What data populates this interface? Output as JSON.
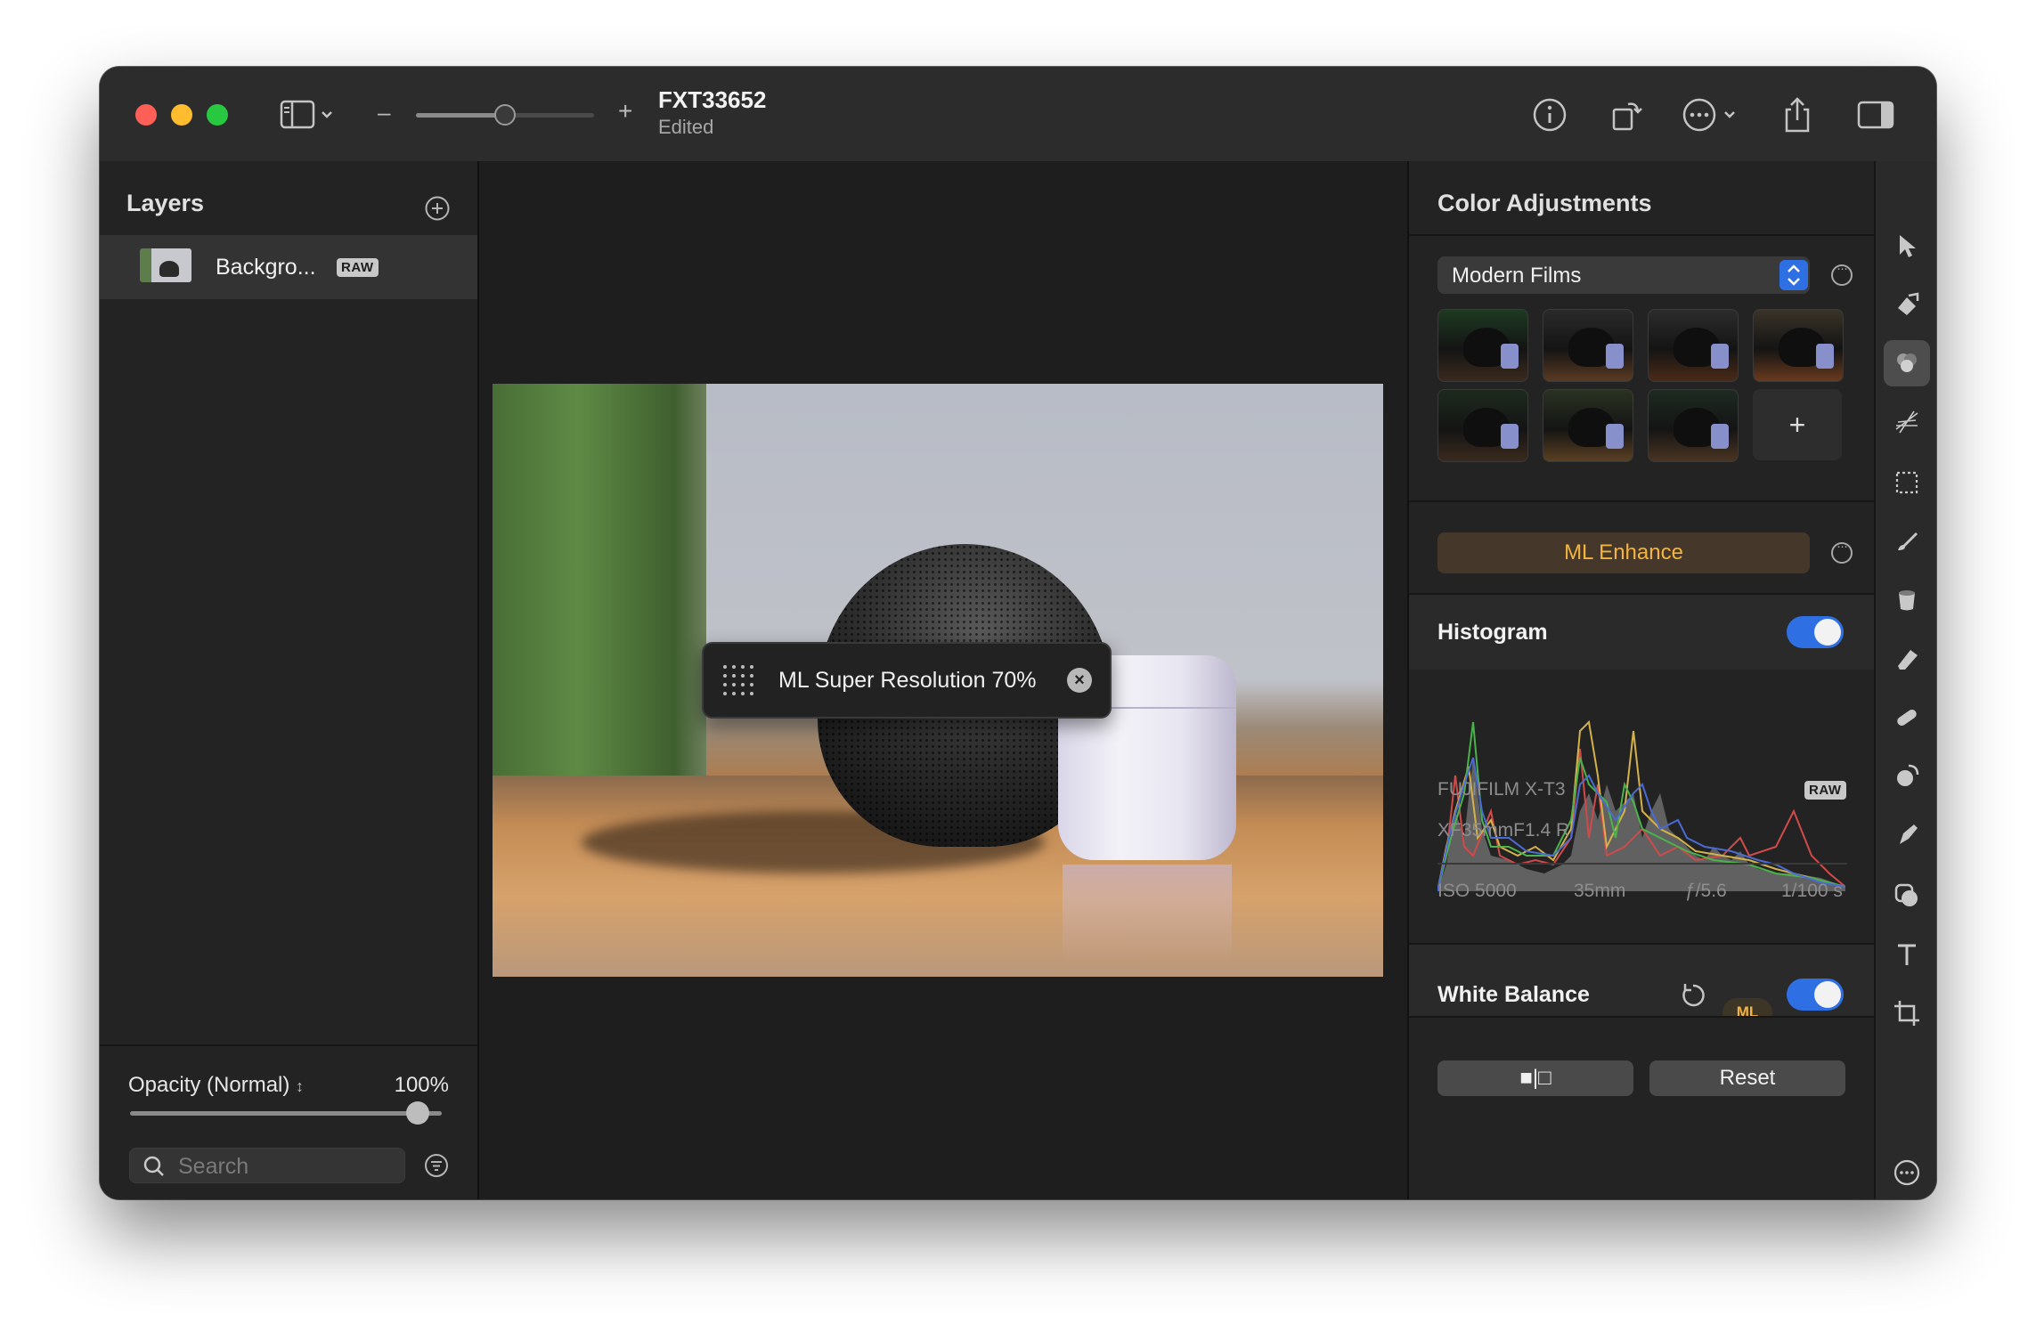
{
  "window": {
    "doc_title": "FXT33652",
    "doc_status": "Edited",
    "zoom_value": 0.5
  },
  "left_panel": {
    "title": "Layers",
    "layers": [
      {
        "name": "Backgro...",
        "badge": "RAW"
      }
    ],
    "opacity_label": "Opacity (Normal)",
    "opacity_value": "100%",
    "opacity_fraction": 1.0,
    "search_placeholder": "Search"
  },
  "canvas": {
    "hud_text": "ML Super Resolution 70%"
  },
  "right_panel": {
    "title": "Color Adjustments",
    "preset": "Modern Films",
    "film_count": 7,
    "add_label": "+",
    "ml_enhance_label": "ML Enhance",
    "histogram_label": "Histogram",
    "histogram_enabled": true,
    "camera": "FUJIFILM X-T3",
    "camera_badge": "RAW",
    "lens": "XF35mmF1.4 R",
    "iso": "ISO 5000",
    "focal": "35mm",
    "aperture": "ƒ/5.6",
    "shutter": "1/100 s",
    "white_balance_label": "White Balance",
    "ml_badge": "ML",
    "white_balance_enabled": true,
    "compare_label": "■|□",
    "reset_label": "Reset"
  },
  "tools": [
    "select-arrow-icon",
    "paint-bucket-icon",
    "color-adjustments-icon",
    "effects-icon",
    "marquee-select-icon",
    "brush-icon",
    "bucket-icon",
    "eraser-icon",
    "bandage-icon",
    "clone-icon",
    "pen-icon",
    "shapes-icon",
    "text-icon",
    "crop-icon",
    "more-icon"
  ],
  "colors": {
    "accent_blue": "#2f6fe4",
    "ml_orange": "#f4b43e",
    "window_bg": "#1f1f1f"
  }
}
